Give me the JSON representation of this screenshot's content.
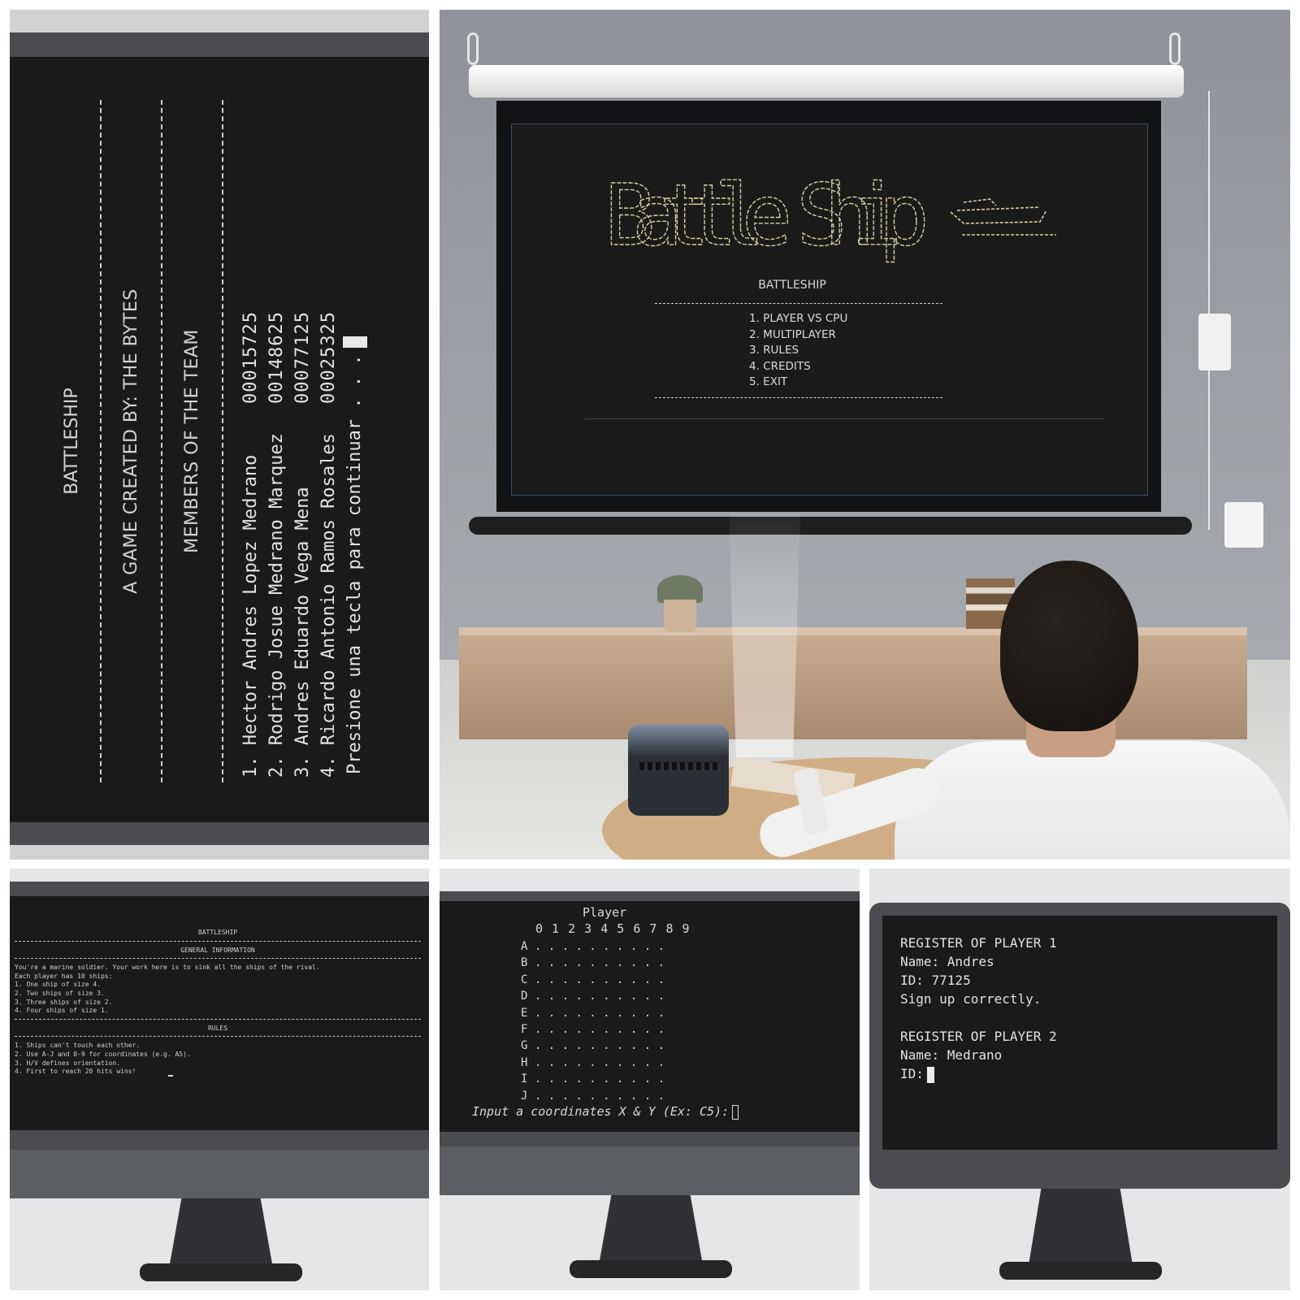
{
  "credits_screen": {
    "title": "BATTLESHIP",
    "created_by": "A GAME CREATED BY: THE BYTES",
    "members_heading": "MEMBERS OF THE TEAM",
    "members": [
      {
        "name": "1. Hector Andres Lopez Medrano",
        "id": "00015725"
      },
      {
        "name": "2. Rodrigo Josue Medrano Marquez",
        "id": "00148625"
      },
      {
        "name": "3. Andres Eduardo Vega Mena",
        "id": "00077125"
      },
      {
        "name": "4. Ricardo Antonio Ramos Rosales",
        "id": "00025325"
      }
    ],
    "prompt": "Presione una tecla para continuar . . ."
  },
  "menu_screen": {
    "logo_text": "Battle Ship",
    "title": "BATTLESHIP",
    "options": [
      "1. PLAYER VS CPU",
      "2. MULTIPLAYER",
      "3. RULES",
      "4. CREDITS",
      "5. EXIT"
    ]
  },
  "rules_screen": {
    "title": "BATTLESHIP",
    "general_heading": "GENERAL INFORMATION",
    "intro": "You're a marine soldier. Your work here is to sink all the ships of the rival.",
    "ships_heading": "Each player has 10 ships:",
    "ships": [
      "1. One ship of size 4.",
      "2. Two ships of size 3.",
      "3. Three ships of size 2.",
      "4. Four ships of size 1."
    ],
    "rules_heading": "RULES",
    "rules": [
      "1. Ships can't touch each other.",
      "2. Use A-J and 0-9 for coordinates (e.g. A5).",
      "3. H/V defines orientation.",
      "4. First to reach 20 hits wins!"
    ]
  },
  "board_screen": {
    "title": "Player",
    "columns": "0 1 2 3 4 5 6 7 8 9",
    "rows": [
      "A",
      "B",
      "C",
      "D",
      "E",
      "F",
      "G",
      "H",
      "I",
      "J"
    ],
    "prompt": "Input a coordinates X & Y (Ex: C5):"
  },
  "register_screen": {
    "p1_heading": "REGISTER OF PLAYER 1",
    "p1_name": "Name: Andres",
    "p1_id": "ID: 77125",
    "p1_status": "Sign up correctly.",
    "p2_heading": "REGISTER OF PLAYER 2",
    "p2_name": "Name: Medrano",
    "p2_id_label": "ID:"
  },
  "colors": {
    "terminal_bg": "#1a1a1a",
    "terminal_text": "#d6d6d6",
    "bezel": "#4a4c50",
    "logo_stroke": "#d8cfa0"
  }
}
